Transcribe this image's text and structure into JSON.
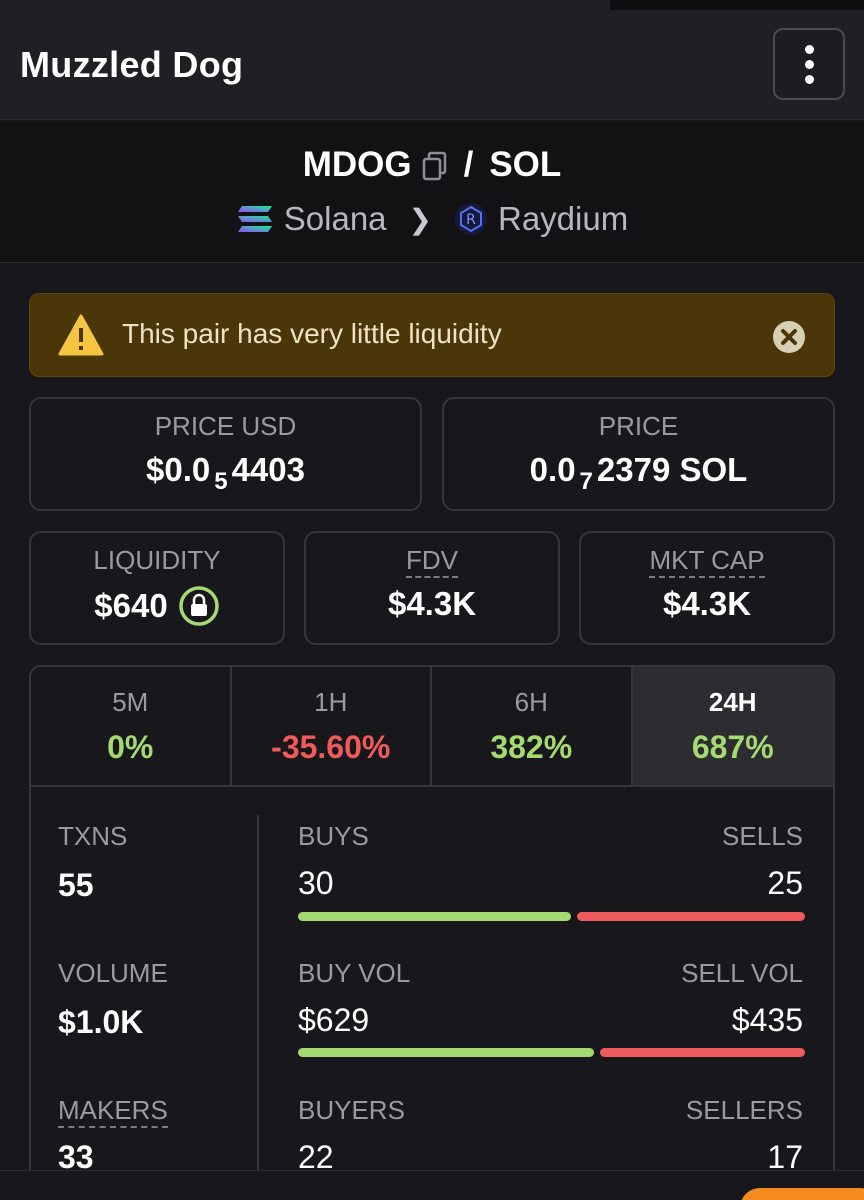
{
  "header": {
    "title": "Muzzled Dog"
  },
  "pair": {
    "base": "MDOG",
    "separator": "/",
    "quote": "SOL",
    "chain": "Solana",
    "dex": "Raydium"
  },
  "warning": {
    "text": "This pair has very little liquidity"
  },
  "price_usd": {
    "label": "PRICE USD",
    "prefix": "$0.0",
    "zeros": "5",
    "digits": "4403"
  },
  "price_native": {
    "label": "PRICE",
    "prefix": "0.0",
    "zeros": "7",
    "digits": "2379 SOL"
  },
  "liquidity": {
    "label": "LIQUIDITY",
    "value": "$640"
  },
  "fdv": {
    "label": "FDV",
    "value": "$4.3K"
  },
  "mkt_cap": {
    "label": "MKT CAP",
    "value": "$4.3K"
  },
  "timeframes": [
    {
      "label": "5M",
      "value": "0%"
    },
    {
      "label": "1H",
      "value": "-35.60%"
    },
    {
      "label": "6H",
      "value": "382%"
    },
    {
      "label": "24H",
      "value": "687%"
    }
  ],
  "stats": {
    "txns": {
      "label": "TXNS",
      "value": "55"
    },
    "volume": {
      "label": "VOLUME",
      "value": "$1.0K"
    },
    "makers": {
      "label": "MAKERS",
      "value": "33"
    },
    "buys": {
      "label": "BUYS",
      "value": "30",
      "share": 0.545
    },
    "sells": {
      "label": "SELLS",
      "value": "25"
    },
    "buy_vol": {
      "label": "BUY VOL",
      "value": "$629",
      "share": 0.591
    },
    "sell_vol": {
      "label": "SELL VOL",
      "value": "$435"
    },
    "buyers": {
      "label": "BUYERS",
      "value": "22"
    },
    "sellers": {
      "label": "SELLERS",
      "value": "17"
    }
  },
  "colors": {
    "positive": "#a5d971",
    "negative": "#ef5b5b",
    "warning_bg": "#4a3608",
    "accent": "#f58a1f"
  }
}
